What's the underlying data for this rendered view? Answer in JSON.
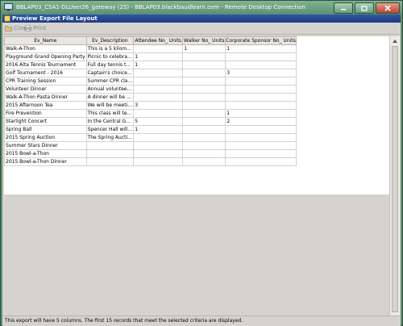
{
  "window": {
    "title": "BBLAP03_CSA1-DLUser26_gateway (25) - BBLAP03.blackbaudlearn.com - Remote Desktop Connection"
  },
  "dialog": {
    "title": "Preview Export File Layout"
  },
  "toolbar": {
    "close_label": "Close",
    "print_label": "Print"
  },
  "table": {
    "columns": [
      "Ev_Name",
      "Ev_Description",
      "Attendee No_ Units",
      "Walker No_ Units",
      "Corporate Sponsor No_ Units"
    ],
    "rows": [
      [
        "Walk-A-Thon",
        "This is a 5 kilom...",
        "",
        "1",
        "1"
      ],
      [
        "Playground Grand Opening Party",
        "Picnic to celebra...",
        "1",
        "",
        ""
      ],
      [
        "2016 Alta Tennis Tournament",
        "Full day tennis t...",
        "1",
        "",
        ""
      ],
      [
        "Golf Tournament - 2016",
        "Captain's choice...",
        "",
        "",
        "3"
      ],
      [
        "CPR Training Session",
        "Summer CPR cla...",
        "",
        "",
        ""
      ],
      [
        "Volunteer Dinner",
        "Annual voluntee...",
        "",
        "",
        ""
      ],
      [
        "Walk-A-Thon Pasta Dinner",
        "A dinner will be ...",
        "",
        "",
        ""
      ],
      [
        "2015 Afternoon Tea",
        "We will be meeti...",
        "3",
        "",
        ""
      ],
      [
        "Fire Prevention",
        "This class will te...",
        "",
        "",
        "1"
      ],
      [
        "Starlight Concert",
        "In the Central G...",
        "5",
        "",
        "2"
      ],
      [
        "Spring Ball",
        "Spencer Hall will...",
        "1",
        "",
        ""
      ],
      [
        "2015 Spring Auction",
        "The Spring Aucti...",
        "",
        "",
        ""
      ],
      [
        "Summer Stars Dinner",
        "",
        "",
        "",
        ""
      ],
      [
        "2015 Bowl-a-Thon",
        "",
        "",
        "",
        ""
      ],
      [
        "2015 Bowl-a-Thon Dinner",
        "",
        "",
        "",
        ""
      ]
    ]
  },
  "status": {
    "text": "This export will have 5 columns. The first 15 records that meet the selected criteria are displayed."
  },
  "colors": {
    "titlebar": "#6a9c7e",
    "dialog_title": "#1c3b80",
    "client_bg": "#d6d3ce"
  }
}
